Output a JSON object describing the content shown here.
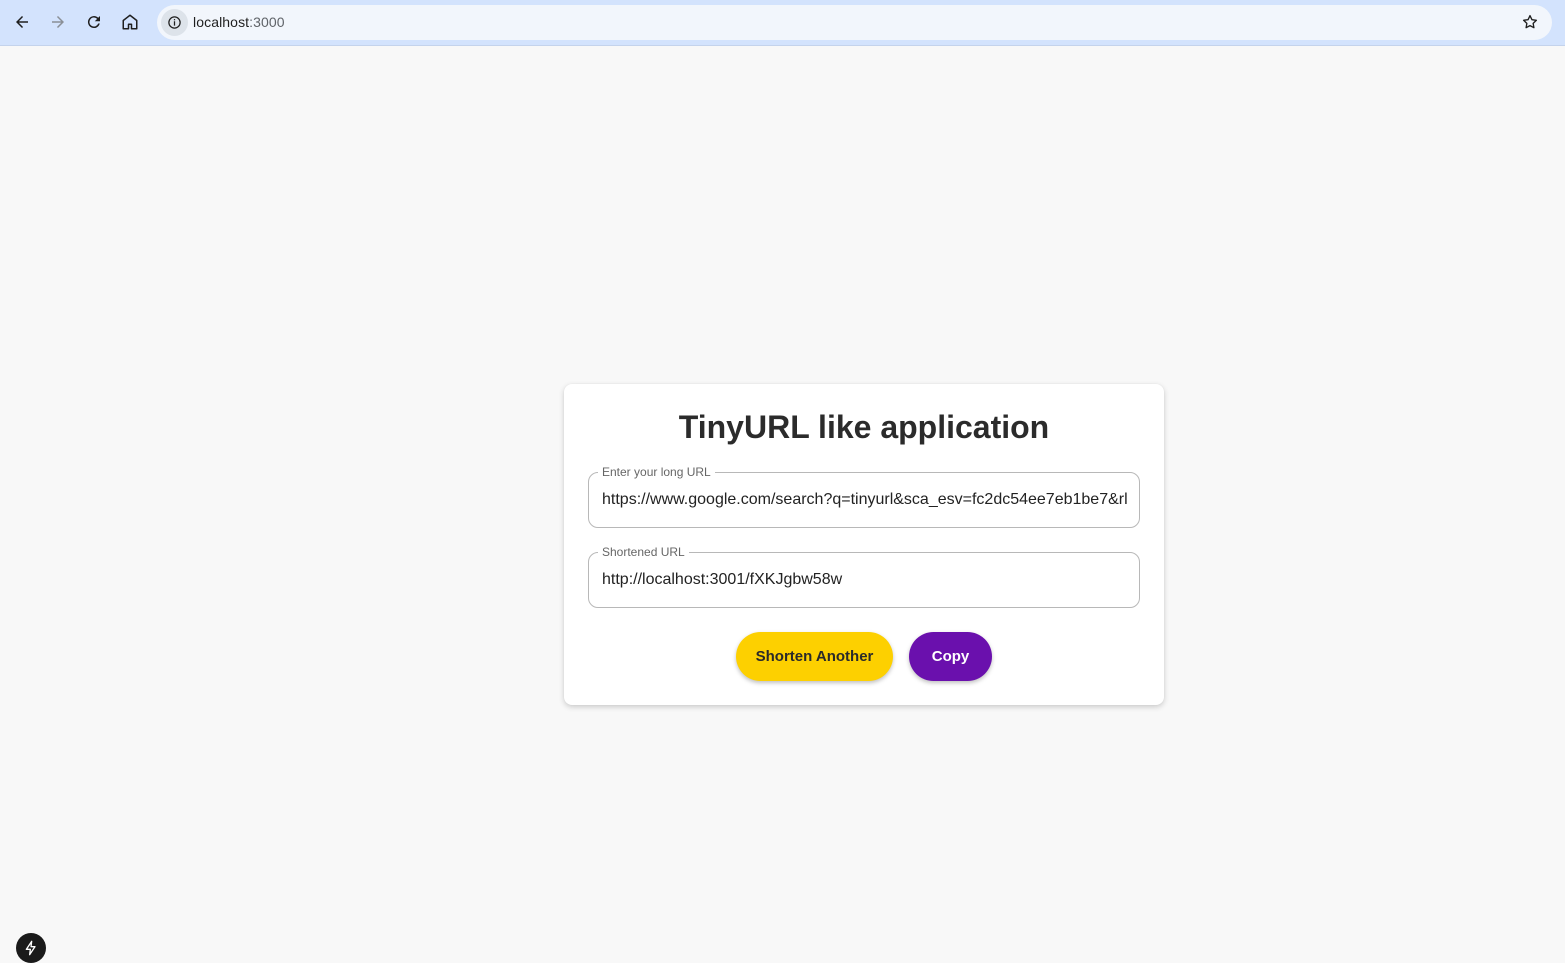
{
  "browser": {
    "address_host": "localhost",
    "address_port": ":3000",
    "icons": {
      "back": "arrow-left-icon",
      "forward": "arrow-right-icon",
      "reload": "reload-icon",
      "home": "home-icon",
      "info": "info-icon",
      "bookmark": "star-icon"
    }
  },
  "app": {
    "title": "TinyURL like application",
    "long_url": {
      "label": "Enter your long URL",
      "value": "https://www.google.com/search?q=tinyurl&sca_esv=fc2dc54ee7eb1be7&rl"
    },
    "short_url": {
      "label": "Shortened URL",
      "value": "http://localhost:3001/fXKJgbw58w"
    },
    "buttons": {
      "shorten_another": "Shorten Another",
      "copy": "Copy"
    }
  },
  "colors": {
    "browser_bar": "#d3e3fd",
    "shorten_button": "#fdd000",
    "copy_button": "#6a10ad",
    "page_background": "#f8f8f8"
  }
}
